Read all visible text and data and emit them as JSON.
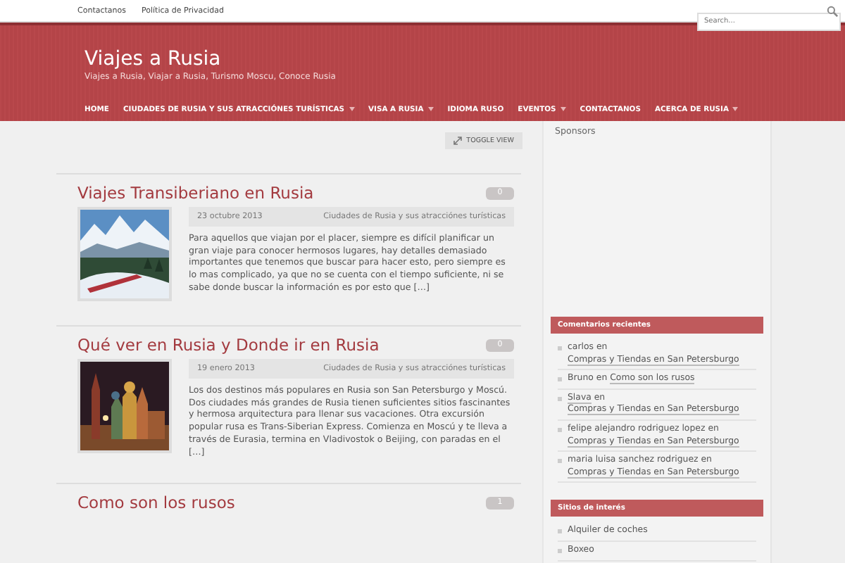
{
  "top_links": [
    "Contactanos",
    "Política de Privacidad"
  ],
  "search": {
    "placeholder": "Search..."
  },
  "site": {
    "title": "Viajes a Rusia",
    "tagline": "Viajes a Rusia, Viajar a Rusia, Turismo Moscu, Conoce Rusia"
  },
  "nav": [
    {
      "label": "HOME",
      "has_submenu": false
    },
    {
      "label": "CIUDADES DE RUSIA Y SUS ATRACCIÓNES TURÍSTICAS",
      "has_submenu": true
    },
    {
      "label": "VISA A RUSIA",
      "has_submenu": true
    },
    {
      "label": "IDIOMA RUSO",
      "has_submenu": false
    },
    {
      "label": "EVENTOS",
      "has_submenu": true
    },
    {
      "label": "CONTACTANOS",
      "has_submenu": false
    },
    {
      "label": "ACERCA DE RUSIA",
      "has_submenu": true
    }
  ],
  "toggle_view": "TOGGLE VIEW",
  "posts": [
    {
      "title": "Viajes Transiberiano en Rusia",
      "comments": "0",
      "date": "23 octubre 2013",
      "category": "Ciudades de Rusia y sus atracciónes turísticas",
      "excerpt": "Para aquellos que viajan por el placer, siempre es difícil planificar un gran viaje para conocer hermosos lugares, hay detalles demasiado importantes que tenemos que buscar para hacer esto, pero siempre es lo mas complicado, ya que no se cuenta con el tiempo suficiente, ni se sabe donde buscar la información es por esto que […]"
    },
    {
      "title": "Qué ver en Rusia y Donde ir en Rusia",
      "comments": "0",
      "date": "19 enero 2013",
      "category": "Ciudades de Rusia y sus atracciónes turísticas",
      "excerpt": "Los dos destinos más populares en Rusia son San Petersburgo y Moscú. Dos ciudades más grandes de Rusia tienen suficientes sitios fascinantes y hermosa arquitectura para llenar sus vacaciones. Otra excursión popular rusa es Trans-Siberian Express. Comienza en Moscú y te lleva a través de Eurasia, termina en Vladivostok o Beijing, con paradas en el […]"
    },
    {
      "title": "Como son los rusos",
      "comments": "1"
    }
  ],
  "sidebar": {
    "sponsors_title": "Sponsors",
    "recent_comments": {
      "title": "Comentarios recientes",
      "items": [
        {
          "author": "carlos",
          "author_linked": false,
          "joiner": "en",
          "post": "Compras y Tiendas en San Petersburgo"
        },
        {
          "author": "Bruno",
          "author_linked": false,
          "joiner": "en",
          "post": "Como son los rusos"
        },
        {
          "author": "Slava",
          "author_linked": true,
          "joiner": "en",
          "post": "Compras y Tiendas en San Petersburgo"
        },
        {
          "author": "felipe alejandro rodriguez lopez",
          "author_linked": false,
          "joiner": "en",
          "post": "Compras y Tiendas en San Petersburgo"
        },
        {
          "author": "maria luisa sanchez rodriguez",
          "author_linked": false,
          "joiner": "en",
          "post": "Compras y Tiendas en San Petersburgo"
        }
      ]
    },
    "sites": {
      "title": "Sitios de interés",
      "items": [
        "Alquiler de coches",
        "Boxeo"
      ]
    }
  }
}
